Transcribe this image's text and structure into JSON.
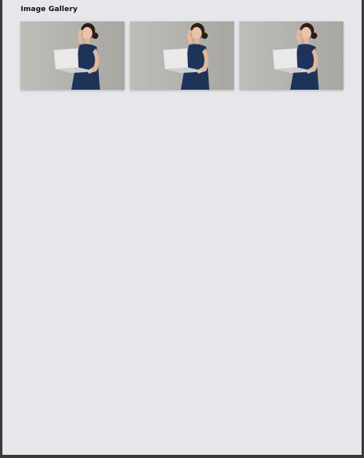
{
  "gallery": {
    "title": "Image Gallery",
    "images": [
      {
        "alt": "",
        "icon": "photo-woman-laptop"
      },
      {
        "alt": "",
        "icon": "photo-woman-laptop"
      },
      {
        "alt": "",
        "icon": "photo-woman-laptop"
      }
    ]
  },
  "colors": {
    "page_background": "#e6e7eb",
    "outer_frame": "#3a3a3c",
    "photo_backdrop": "#b9b7b2",
    "dress": "#1d3357",
    "laptop": "#e9e9ea",
    "title_text": "#111111"
  }
}
